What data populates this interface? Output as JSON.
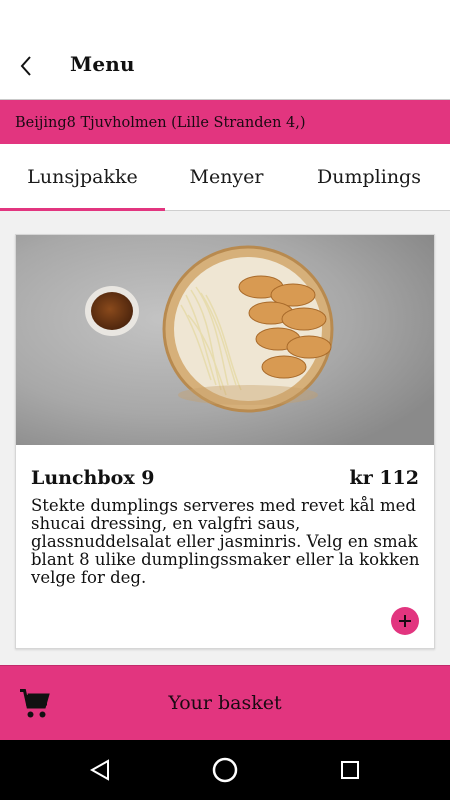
{
  "header": {
    "title": "Menu",
    "back_icon": "chevron-left-icon"
  },
  "location": {
    "text": "Beijing8 Tjuvholmen (Lille Stranden 4,)"
  },
  "tabs": [
    {
      "label": "Lunsjpakke",
      "active": true
    },
    {
      "label": "Menyer",
      "active": false
    },
    {
      "label": "Dumplings",
      "active": false
    }
  ],
  "item": {
    "name": "Lunchbox 9",
    "price": "kr 112",
    "description": "Stekte dumplings serveres med revet kål med shucai dressing, en valgfri saus, glassnuddelsalat eller jasminris. Velg en smak blant 8 ulike dumplingssmaker eller la kokken velge for deg.",
    "add_icon": "plus-icon"
  },
  "basket": {
    "label": "Your basket",
    "icon": "cart-icon"
  },
  "system_nav": {
    "back_icon": "triangle-back-icon",
    "home_icon": "circle-home-icon",
    "recents_icon": "square-recents-icon"
  },
  "colors": {
    "accent": "#e2357f",
    "background": "#f1f1f1",
    "navbar": "#000000"
  }
}
